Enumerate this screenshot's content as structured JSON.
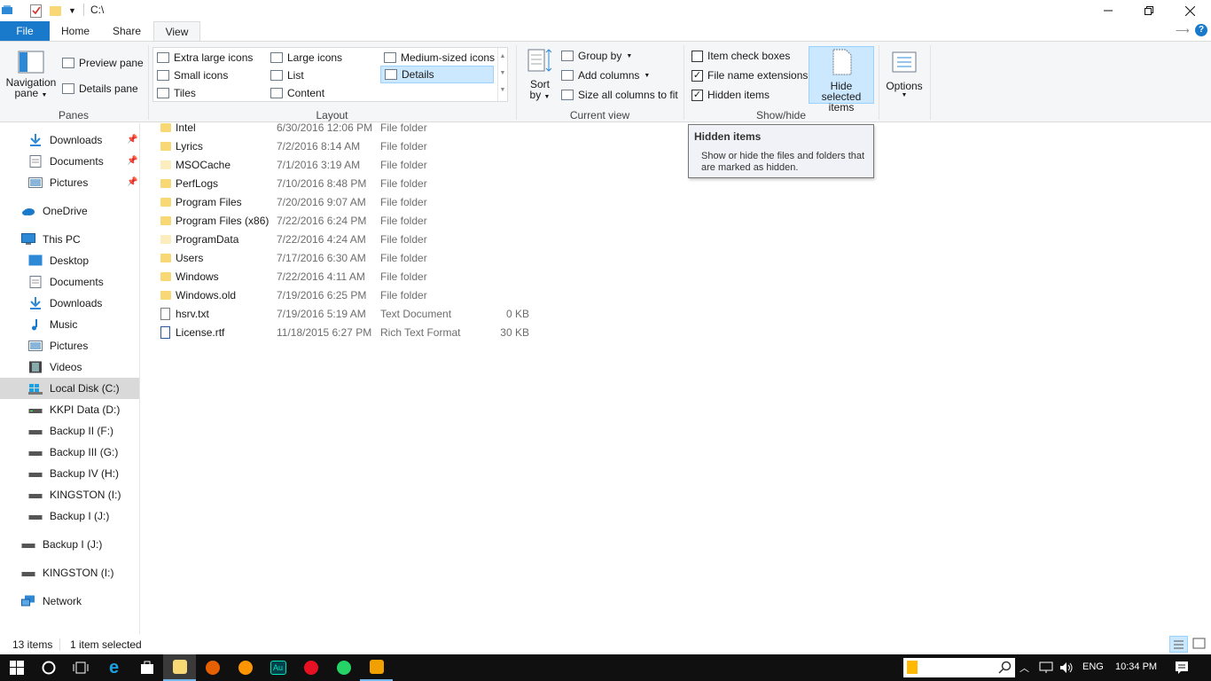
{
  "window": {
    "title": "C:\\"
  },
  "ribbon_tabs": [
    "File",
    "Home",
    "Share",
    "View"
  ],
  "panes": {
    "group_label": "Panes",
    "navigation_pane": [
      "Navigation",
      "pane"
    ],
    "preview_pane": "Preview pane",
    "details_pane": "Details pane"
  },
  "layout": {
    "group_label": "Layout",
    "options": [
      "Extra large icons",
      "Large icons",
      "Medium-sized icons",
      "Small icons",
      "List",
      "Details",
      "Tiles",
      "Content"
    ],
    "selected": "Details"
  },
  "current_view": {
    "group_label": "Current view",
    "sort_by": [
      "Sort",
      "by"
    ],
    "group_by": "Group by",
    "add_columns": "Add columns",
    "size_all_columns": "Size all columns to fit"
  },
  "show_hide": {
    "group_label": "Show/hide",
    "item_check_boxes": {
      "label": "Item check boxes",
      "checked": false
    },
    "file_name_extensions": {
      "label": "File name extensions",
      "checked": true
    },
    "hidden_items": {
      "label": "Hidden items",
      "checked": true
    },
    "hide_selected_items": [
      "Hide selected",
      "items"
    ]
  },
  "options": {
    "label": "Options"
  },
  "tooltip": {
    "title": "Hidden items",
    "description": "Show or hide the files and folders that are marked as hidden."
  },
  "nav": {
    "quick_access": [
      "Downloads",
      "Documents",
      "Pictures"
    ],
    "onedrive": "OneDrive",
    "this_pc": "This PC",
    "this_pc_items": [
      "Desktop",
      "Documents",
      "Downloads",
      "Music",
      "Pictures",
      "Videos",
      "Local Disk (C:)",
      "KKPI Data (D:)",
      "Backup II (F:)",
      "Backup III (G:)",
      "Backup IV (H:)",
      "KINGSTON (I:)",
      "Backup I (J:)"
    ],
    "drives": [
      "Backup I (J:)",
      "KINGSTON (I:)"
    ],
    "network": "Network"
  },
  "files": [
    {
      "name": "Intel",
      "date": "6/30/2016 12:06 PM",
      "type": "File folder",
      "size": ""
    },
    {
      "name": "Lyrics",
      "date": "7/2/2016 8:14 AM",
      "type": "File folder",
      "size": ""
    },
    {
      "name": "MSOCache",
      "date": "7/1/2016 3:19 AM",
      "type": "File folder",
      "size": ""
    },
    {
      "name": "PerfLogs",
      "date": "7/10/2016 8:48 PM",
      "type": "File folder",
      "size": ""
    },
    {
      "name": "Program Files",
      "date": "7/20/2016 9:07 AM",
      "type": "File folder",
      "size": ""
    },
    {
      "name": "Program Files (x86)",
      "date": "7/22/2016 6:24 PM",
      "type": "File folder",
      "size": ""
    },
    {
      "name": "ProgramData",
      "date": "7/22/2016 4:24 AM",
      "type": "File folder",
      "size": ""
    },
    {
      "name": "Users",
      "date": "7/17/2016 6:30 AM",
      "type": "File folder",
      "size": ""
    },
    {
      "name": "Windows",
      "date": "7/22/2016 4:11 AM",
      "type": "File folder",
      "size": ""
    },
    {
      "name": "Windows.old",
      "date": "7/19/2016 6:25 PM",
      "type": "File folder",
      "size": ""
    },
    {
      "name": "hsrv.txt",
      "date": "7/19/2016 5:19 AM",
      "type": "Text Document",
      "size": "0 KB"
    },
    {
      "name": "License.rtf",
      "date": "11/18/2015 6:27 PM",
      "type": "Rich Text Format",
      "size": "30 KB"
    }
  ],
  "status": {
    "item_count": "13 items",
    "selection": "1 item selected"
  },
  "taskbar": {
    "language": "ENG",
    "time": "10:34 PM"
  },
  "colors": {
    "accent": "#1979ca",
    "selected": "#cce8ff",
    "folder": "#f8d775",
    "taskbar": "#101010"
  }
}
